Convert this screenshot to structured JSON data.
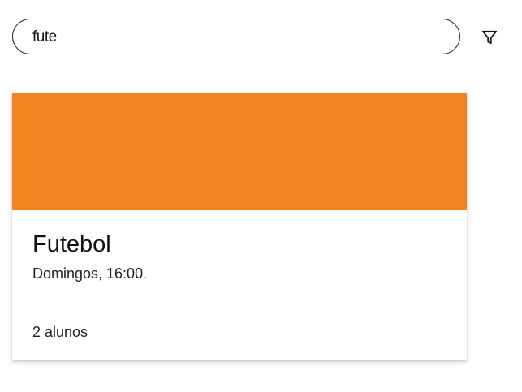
{
  "search": {
    "value": "fute",
    "placeholder": ""
  },
  "filter": {
    "icon": "filter-icon"
  },
  "cards": [
    {
      "title": "Futebol",
      "schedule": "Domingos, 16:00.",
      "students": "2 alunos",
      "color": "#F58420"
    }
  ]
}
